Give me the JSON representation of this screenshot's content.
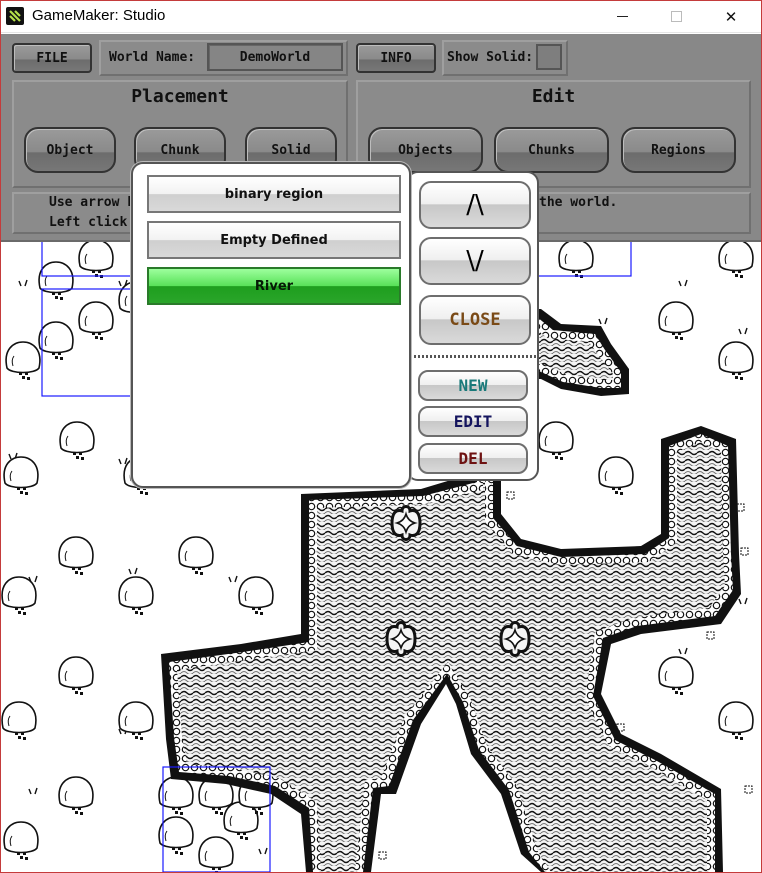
{
  "window": {
    "title": "GameMaker: Studio",
    "close_glyph": "✕"
  },
  "toolbar": {
    "file_label": "FILE",
    "world_name_label": "World Name:",
    "world_name_value": "DemoWorld",
    "info_label": "INFO",
    "show_solid_label": "Show Solid:",
    "placement": {
      "heading": "Placement",
      "buttons": [
        "Object",
        "Chunk",
        "Solid"
      ]
    },
    "edit": {
      "heading": "Edit",
      "buttons": [
        "Objects",
        "Chunks",
        "Regions"
      ]
    },
    "help_lines": [
      "Use arrow k",
      "Left click to",
      "the world."
    ]
  },
  "region_popup": {
    "items": [
      {
        "label": "binary region",
        "selected": false
      },
      {
        "label": "Empty Defined",
        "selected": false
      },
      {
        "label": "River",
        "selected": true
      }
    ],
    "up_label": "/\\",
    "down_label": "\\/",
    "close_label": "CLOSE",
    "new_label": "NEW",
    "edit_label": "EDIT",
    "del_label": "DEL",
    "colors": {
      "close": "#7a4a16",
      "new": "#1a7a7a",
      "edit": "#14145e",
      "del": "#6e1212",
      "selected": "#2aa52a"
    }
  }
}
